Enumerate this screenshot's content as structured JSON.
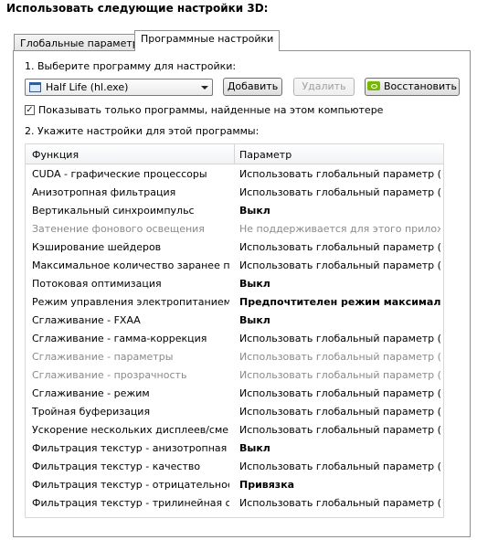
{
  "page": {
    "heading": "Использовать следующие настройки 3D:"
  },
  "tabs": [
    {
      "label": "Глобальные параметры",
      "active": false
    },
    {
      "label": "Программные настройки",
      "active": true
    }
  ],
  "step1": {
    "label": "1. Выберите программу для настройки:",
    "selected_program": "Half Life (hl.exe)",
    "add_button": "Добавить",
    "remove_button": "Удалить",
    "restore_button": "Восстановить",
    "show_found_only": {
      "checked": true,
      "label": "Показывать только программы, найденные на этом компьютере"
    }
  },
  "step2": {
    "label": "2. Укажите настройки для этой программы:",
    "columns": [
      "Функция",
      "Параметр"
    ],
    "rows": [
      {
        "feature": "CUDA - графические процессоры",
        "value": "Использовать глобальный параметр (Все)"
      },
      {
        "feature": "Анизотропная фильтрация",
        "value": "Использовать глобальный параметр (В..."
      },
      {
        "feature": "Вертикальный синхроимпульс",
        "value": "Выкл"
      },
      {
        "feature": "Затенение фонового освещения",
        "value": "Не поддерживается для этого приложе..."
      },
      {
        "feature": "Кэширование шейдеров",
        "value": "Использовать глобальный параметр (В..."
      },
      {
        "feature": "Максимальное количество заранее под...",
        "value": "Использовать глобальный параметр (И..."
      },
      {
        "feature": "Потоковая оптимизация",
        "value": "Выкл"
      },
      {
        "feature": "Режим управления электропитанием",
        "value": "Предпочтителен режим максимал..."
      },
      {
        "feature": "Сглаживание - FXAA",
        "value": "Выкл"
      },
      {
        "feature": "Сглаживание - гамма-коррекция",
        "value": "Использовать глобальный параметр (Вкл)"
      },
      {
        "feature": "Сглаживание - параметры",
        "value": "Использовать глобальный параметр (Нет)"
      },
      {
        "feature": "Сглаживание - прозрачность",
        "value": "Использовать глобальный параметр (В..."
      },
      {
        "feature": "Сглаживание - режим",
        "value": "Использовать глобальный параметр (В..."
      },
      {
        "feature": "Тройная буферизация",
        "value": "Использовать глобальный параметр (В..."
      },
      {
        "feature": "Ускорение нескольких дисплеев/смеша...",
        "value": "Использовать глобальный параметр (Р..."
      },
      {
        "feature": "Фильтрация текстур - анизотропная оп...",
        "value": "Выкл"
      },
      {
        "feature": "Фильтрация текстур - качество",
        "value": "Использовать глобальный параметр (К..."
      },
      {
        "feature": "Фильтрация текстур - отрицательное о...",
        "value": "Привязка"
      },
      {
        "feature": "Фильтрация текстур - трилинейная опт...",
        "value": "Использовать глобальный параметр (Вкл)"
      }
    ]
  }
}
